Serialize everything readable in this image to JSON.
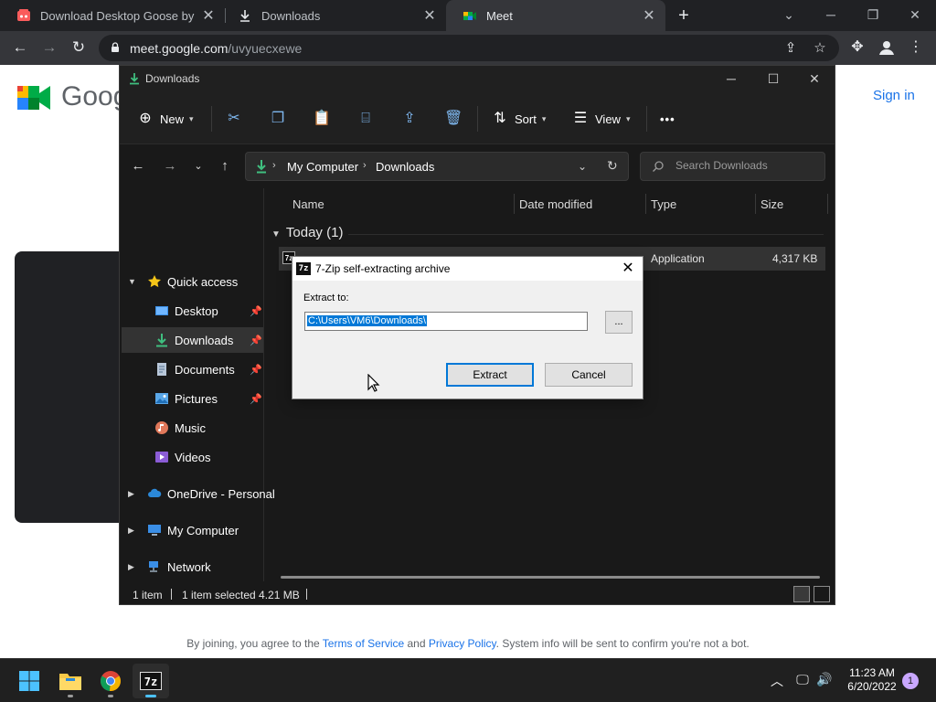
{
  "browser": {
    "tabs": [
      {
        "title": "Download Desktop Goose by sam"
      },
      {
        "title": "Downloads"
      },
      {
        "title": "Meet"
      }
    ],
    "url_host": "meet.google.com",
    "url_path": "/uvyuecxewe"
  },
  "meet": {
    "wordmark": "Goog",
    "sign_in": "Sign in",
    "footer": {
      "pre": "By joining, you agree to the",
      "terms": "Terms of Service",
      "and": "and",
      "privacy": "Privacy Policy",
      "post": ". System info will be sent to confirm you're not a bot."
    }
  },
  "explorer": {
    "title": "Downloads",
    "commands": {
      "new": "New",
      "sort": "Sort",
      "view": "View",
      "more": "•••"
    },
    "breadcrumb": [
      "My Computer",
      "Downloads"
    ],
    "search_placeholder": "Search Downloads",
    "nav": {
      "quick_access": "Quick access",
      "items": [
        "Desktop",
        "Downloads",
        "Documents",
        "Pictures",
        "Music",
        "Videos"
      ],
      "onedrive": "OneDrive - Personal",
      "my_computer": "My Computer",
      "network": "Network"
    },
    "columns": {
      "name": "Name",
      "date": "Date modified",
      "type": "Type",
      "size": "Size"
    },
    "group": "Today (1)",
    "file": {
      "type": "Application",
      "size": "4,317 KB"
    },
    "status": {
      "count": "1 item",
      "selected": "1 item selected  4.21 MB"
    }
  },
  "dialog": {
    "title": "7-Zip self-extracting archive",
    "extract_label": "Extract to:",
    "path": "C:\\Users\\VM6\\Downloads\\",
    "browse": "...",
    "extract_button": "Extract",
    "cancel_button": "Cancel"
  },
  "taskbar": {
    "time": "11:23 AM",
    "date": "6/20/2022",
    "notifications": "1"
  },
  "colors": {
    "chrome_dark": "#202124",
    "chrome_toolbar": "#35363a",
    "explorer_bg": "#191919",
    "accent_blue": "#0078d7",
    "meet_link": "#1a73e8",
    "download_green": "#3fbf7f"
  }
}
